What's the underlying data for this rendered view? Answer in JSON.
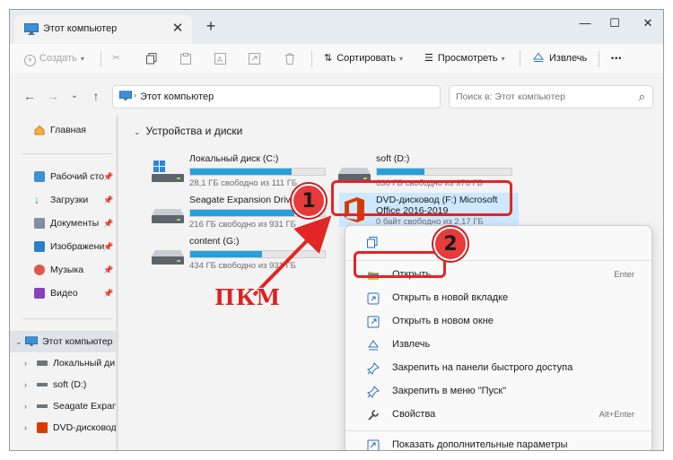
{
  "colors": {
    "accent": "#26a0da",
    "annotation_red": "#e22525",
    "selection": "#cde8ff"
  },
  "window": {
    "tab_title": "Этот компьютер",
    "tab_close": "✕",
    "new_tab": "+",
    "minimize": "—",
    "maximize": "☐",
    "close": "✕"
  },
  "toolbar": {
    "create_label": "Создать",
    "sort_label": "Сортировать",
    "view_label": "Просмотреть",
    "eject_label": "Извлечь",
    "more_label": "•••"
  },
  "address": {
    "path": "Этот компьютер",
    "search_placeholder": "Поиск в: Этот компьютер"
  },
  "sidebar": {
    "home": "Главная",
    "pinned": [
      {
        "label": "Рабочий сто",
        "icon": "desktop-icon"
      },
      {
        "label": "Загрузки",
        "icon": "downloads-icon"
      },
      {
        "label": "Документы",
        "icon": "documents-icon"
      },
      {
        "label": "Изображени",
        "icon": "pictures-icon"
      },
      {
        "label": "Музыка",
        "icon": "music-icon"
      },
      {
        "label": "Видео",
        "icon": "video-icon"
      }
    ],
    "tree": [
      {
        "label": "Этот компьютер"
      },
      {
        "label": "Локальный ди"
      },
      {
        "label": "soft (D:)"
      },
      {
        "label": "Seagate Expans"
      },
      {
        "label": "DVD-дисковод"
      }
    ]
  },
  "content": {
    "group_title": "Устройства и диски",
    "drives": [
      {
        "name": "Локальный диск (C:)",
        "free": "28,1 ГБ свободно из 111 ГБ",
        "used_fraction": 0.75
      },
      {
        "name": "soft (D:)",
        "free": "636 ГБ свободно из 976 ГБ",
        "used_fraction": 0.35
      },
      {
        "name": "Seagate Expansion Drive (E:)",
        "free": "216 ГБ свободно из 931 ГБ",
        "used_fraction": 0.77
      },
      {
        "name": "content (G:)",
        "free": "434 ГБ свободно из 931 ГБ",
        "used_fraction": 0.53
      }
    ],
    "dvd": {
      "name_line1": "DVD-дисковод (F:) Microsoft",
      "name_line2": "Office 2016-2019",
      "free": "0 байт свободно из 2,17 ГБ"
    }
  },
  "context_menu": {
    "items": [
      {
        "label": "Открыть",
        "shortcut": "Enter",
        "icon": "folder-open-icon"
      },
      {
        "label": "Открыть в новой вкладке",
        "shortcut": "",
        "icon": "new-tab-icon"
      },
      {
        "label": "Открыть в новом окне",
        "shortcut": "",
        "icon": "new-window-icon"
      },
      {
        "label": "Извлечь",
        "shortcut": "",
        "icon": "eject-icon"
      },
      {
        "label": "Закрепить на панели быстрого доступа",
        "shortcut": "",
        "icon": "pin-icon"
      },
      {
        "label": "Закрепить в меню \"Пуск\"",
        "shortcut": "",
        "icon": "pin-icon"
      },
      {
        "label": "Свойства",
        "shortcut": "Alt+Enter",
        "icon": "wrench-icon"
      },
      {
        "label": "Показать дополнительные параметры",
        "shortcut": "",
        "icon": "more-options-icon"
      }
    ]
  },
  "annotations": {
    "step1": "1",
    "step2": "2",
    "rmb_label": "ПКМ"
  }
}
